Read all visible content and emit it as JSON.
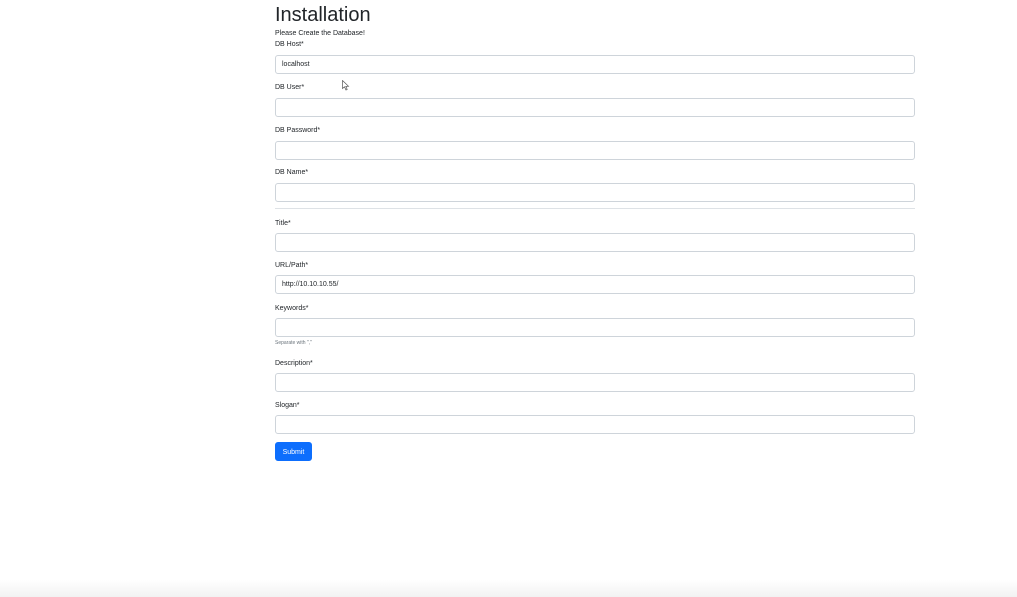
{
  "page": {
    "title": "Installation",
    "intro": "Please Create the Database!"
  },
  "form": {
    "db_host": {
      "label": "DB Host*",
      "value": "localhost"
    },
    "db_user": {
      "label": "DB User*",
      "value": ""
    },
    "db_password": {
      "label": "DB Password*",
      "value": ""
    },
    "db_name": {
      "label": "DB Name*",
      "value": ""
    },
    "title": {
      "label": "Title*",
      "value": ""
    },
    "url_path": {
      "label": "URL/Path*",
      "value": "http://10.10.10.55/"
    },
    "keywords": {
      "label": "Keywords*",
      "value": "",
      "help": "Separate with \",\""
    },
    "description": {
      "label": "Description*",
      "value": ""
    },
    "slogan": {
      "label": "Slogan*",
      "value": ""
    },
    "submit_label": "Submit"
  },
  "colors": {
    "primary": "#0d6efd",
    "border": "#ced4da"
  }
}
